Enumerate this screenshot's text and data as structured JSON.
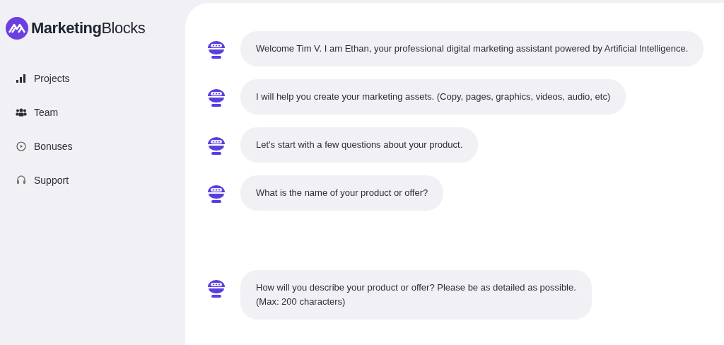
{
  "brand": "**Marketing**Blocks",
  "nav": [
    {
      "label": "Projects",
      "kind": "bars"
    },
    {
      "label": "Team",
      "kind": "team"
    },
    {
      "label": "Bonuses",
      "kind": "play"
    },
    {
      "label": "Support",
      "kind": "headset"
    }
  ],
  "messages": [
    {
      "lines": [
        "Welcome Tim V. I am Ethan, your professional digital marketing assistant powered by Artificial Intelligence."
      ]
    },
    {
      "lines": [
        "I will help you create your marketing assets. (Copy, pages, graphics, videos, audio, etc)"
      ]
    },
    {
      "lines": [
        "Let's start with a few questions about your product."
      ]
    },
    {
      "lines": [
        "What is the name of your product or offer?"
      ]
    },
    {
      "lines": [
        "How will you describe your product or offer? Please be as detailed as possible.",
        "(Max: 200 characters)"
      ]
    }
  ]
}
